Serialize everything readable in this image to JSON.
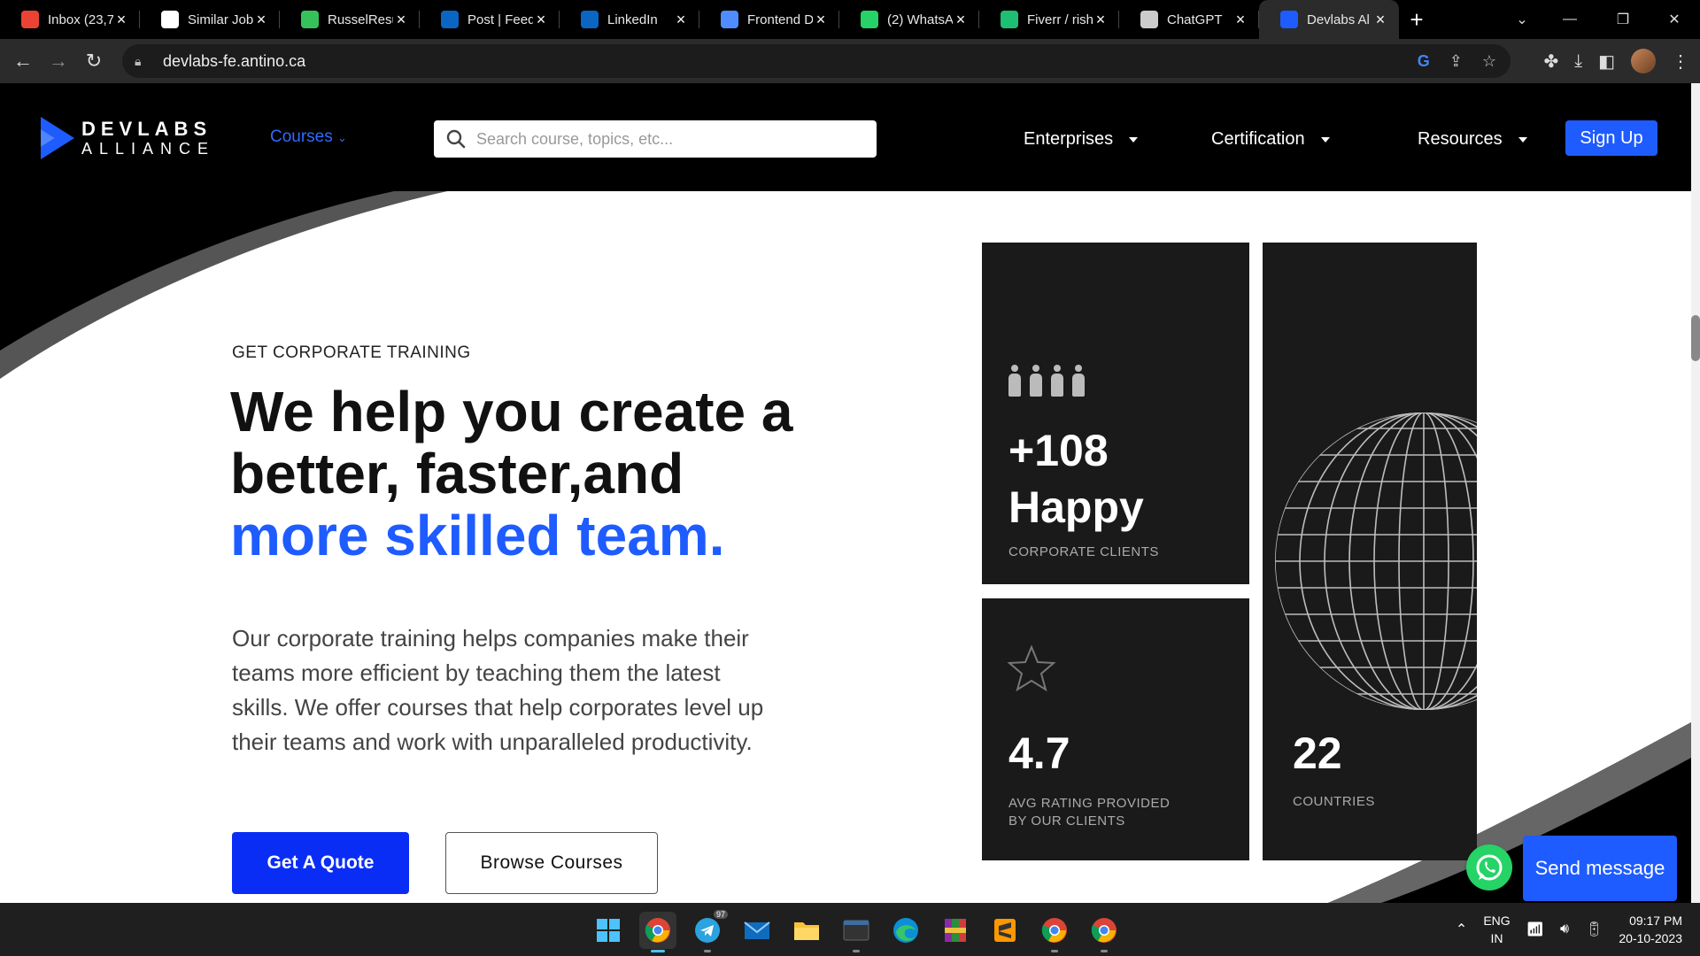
{
  "browser": {
    "tabs": [
      {
        "label": "Inbox (23,7",
        "icon": "gmail-icon",
        "color": "#ea4335"
      },
      {
        "label": "Similar Job",
        "icon": "similar-jobs-icon",
        "color": "#ffffff"
      },
      {
        "label": "RusselResu",
        "icon": "resume-site-icon",
        "color": "#36c25b"
      },
      {
        "label": "Post | Feed",
        "icon": "linkedin-icon",
        "color": "#0a66c2"
      },
      {
        "label": "LinkedIn",
        "icon": "linkedin-icon",
        "color": "#0a66c2"
      },
      {
        "label": "Frontend D",
        "icon": "document-icon",
        "color": "#4f8cff"
      },
      {
        "label": "(2) WhatsA",
        "icon": "whatsapp-icon",
        "color": "#25d366"
      },
      {
        "label": "Fiverr / rish",
        "icon": "fiverr-icon",
        "color": "#1dbf73"
      },
      {
        "label": "ChatGPT",
        "icon": "chatgpt-icon",
        "color": "#cccccc"
      },
      {
        "label": "Devlabs Al",
        "icon": "devlabs-icon",
        "color": "#1e5cff",
        "active": true
      }
    ],
    "url": "devlabs-fe.antino.ca"
  },
  "site": {
    "logo_word1": "DEVLABS",
    "logo_word2": "ALLIANCE",
    "courses_label": "Courses",
    "search_placeholder": "Search course, topics, etc...",
    "menu": [
      {
        "label": "Enterprises"
      },
      {
        "label": "Certification"
      },
      {
        "label": "Resources"
      }
    ],
    "signup_label": "Sign Up",
    "accent": "#1e5cff"
  },
  "hero": {
    "eyebrow": "GET CORPORATE TRAINING",
    "headline_line1": "We help you create a",
    "headline_line2": "better, faster,and",
    "headline_line3": "more skilled team.",
    "description": "Our corporate training helps companies make their teams more efficient by teaching them the latest skills. We offer courses that help corporates level up their teams and work with unparalleled productivity.",
    "quote_button": "Get A Quote",
    "browse_button": "Browse Courses"
  },
  "stats": {
    "clients_value": "+108",
    "clients_word": "Happy",
    "clients_caption": "CORPORATE CLIENTS",
    "rating_value": "4.7",
    "rating_caption_line1": "AVG RATING PROVIDED",
    "rating_caption_line2": "BY OUR CLIENTS",
    "countries_value": "22",
    "countries_caption": "COUNTRIES"
  },
  "chat": {
    "send_label": "Send message"
  },
  "taskbar": {
    "apps": [
      "windows-start-icon",
      "chrome-icon",
      "telegram-icon",
      "mail-icon",
      "file-explorer-icon",
      "mysql-icon",
      "edge-icon",
      "winrar-icon",
      "sublime-icon",
      "chrome-icon",
      "chrome-icon"
    ],
    "telegram_badge": "97",
    "lang_line1": "ENG",
    "lang_line2": "IN",
    "time": "09:17 PM",
    "date": "20-10-2023"
  }
}
